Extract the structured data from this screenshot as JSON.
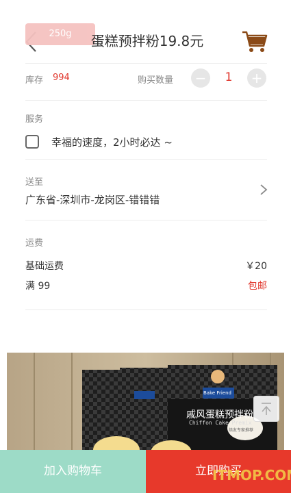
{
  "header": {
    "weight_tag": "250g",
    "title": "蛋糕预拌粉19.8元",
    "cart_icon": "shopping-cart-icon",
    "back_icon": "chevron-left-icon"
  },
  "stock": {
    "label": "库存",
    "value": "994"
  },
  "quantity": {
    "label": "购买数量",
    "minus": "−",
    "value": "1",
    "plus": "+"
  },
  "service": {
    "label": "服务",
    "option": "幸福的速度，2小时必达 ~"
  },
  "delivery": {
    "label": "送至",
    "address": "广东省-深圳市-龙岗区-错错错"
  },
  "freight": {
    "label": "运费",
    "rows": [
      {
        "name": "基础运费",
        "value": "￥20"
      },
      {
        "name": "满 99",
        "value": "包邮"
      }
    ]
  },
  "photo": {
    "brand": "Bake Friend",
    "product_cn": "戚风蛋糕预拌粉",
    "product_en": "Chiffon Cake Premix",
    "badge": "焙友专家推荐"
  },
  "bottom": {
    "add_to_cart": "加入购物车",
    "buy_now": "立即购买"
  },
  "watermark": "ITMOP.COM",
  "colors": {
    "accent_red": "#e7392b",
    "mint": "#9ddbc7",
    "tag_pink": "#f5c2c0"
  }
}
